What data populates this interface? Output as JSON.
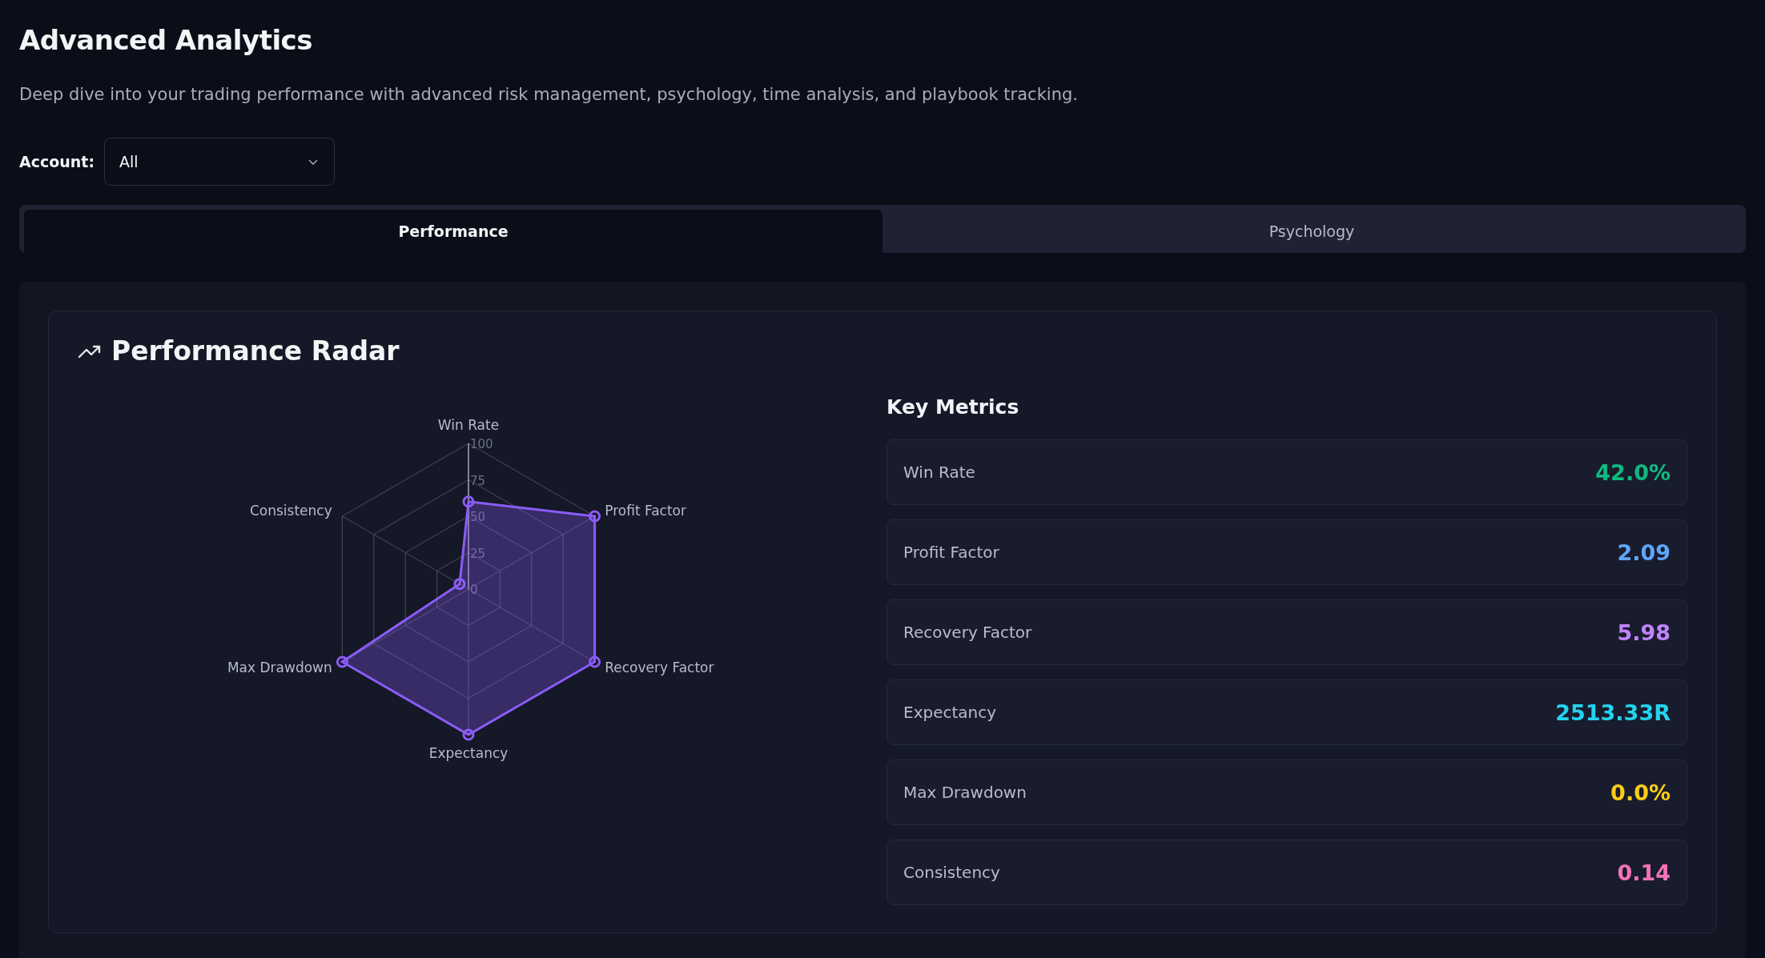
{
  "page": {
    "title": "Advanced Analytics",
    "subtitle": "Deep dive into your trading performance with advanced risk management, psychology, time analysis, and playbook tracking."
  },
  "account_filter": {
    "label": "Account:",
    "value": "All"
  },
  "tabs": [
    {
      "label": "Performance",
      "selected": true
    },
    {
      "label": "Psychology",
      "selected": false
    }
  ],
  "card": {
    "title": "Performance Radar",
    "chart_data": {
      "type": "radar",
      "categories": [
        "Win Rate",
        "Profit Factor",
        "Recovery Factor",
        "Expectancy",
        "Max Drawdown",
        "Consistency"
      ],
      "ylim": [
        0,
        100
      ],
      "yticks": [
        0,
        25,
        50,
        75,
        100
      ],
      "series": [
        {
          "color": "#8b5cf6",
          "values": [
            60,
            100,
            100,
            100,
            100,
            7
          ]
        }
      ]
    },
    "metrics_title": "Key Metrics",
    "metrics": [
      {
        "label": "Win Rate",
        "value": "42.0%",
        "color": "#10b981"
      },
      {
        "label": "Profit Factor",
        "value": "2.09",
        "color": "#60a5fa"
      },
      {
        "label": "Recovery Factor",
        "value": "5.98",
        "color": "#c084fc"
      },
      {
        "label": "Expectancy",
        "value": "2513.33R",
        "color": "#22d3ee"
      },
      {
        "label": "Max Drawdown",
        "value": "0.0%",
        "color": "#facc15"
      },
      {
        "label": "Consistency",
        "value": "0.14",
        "color": "#f472b6"
      }
    ]
  }
}
